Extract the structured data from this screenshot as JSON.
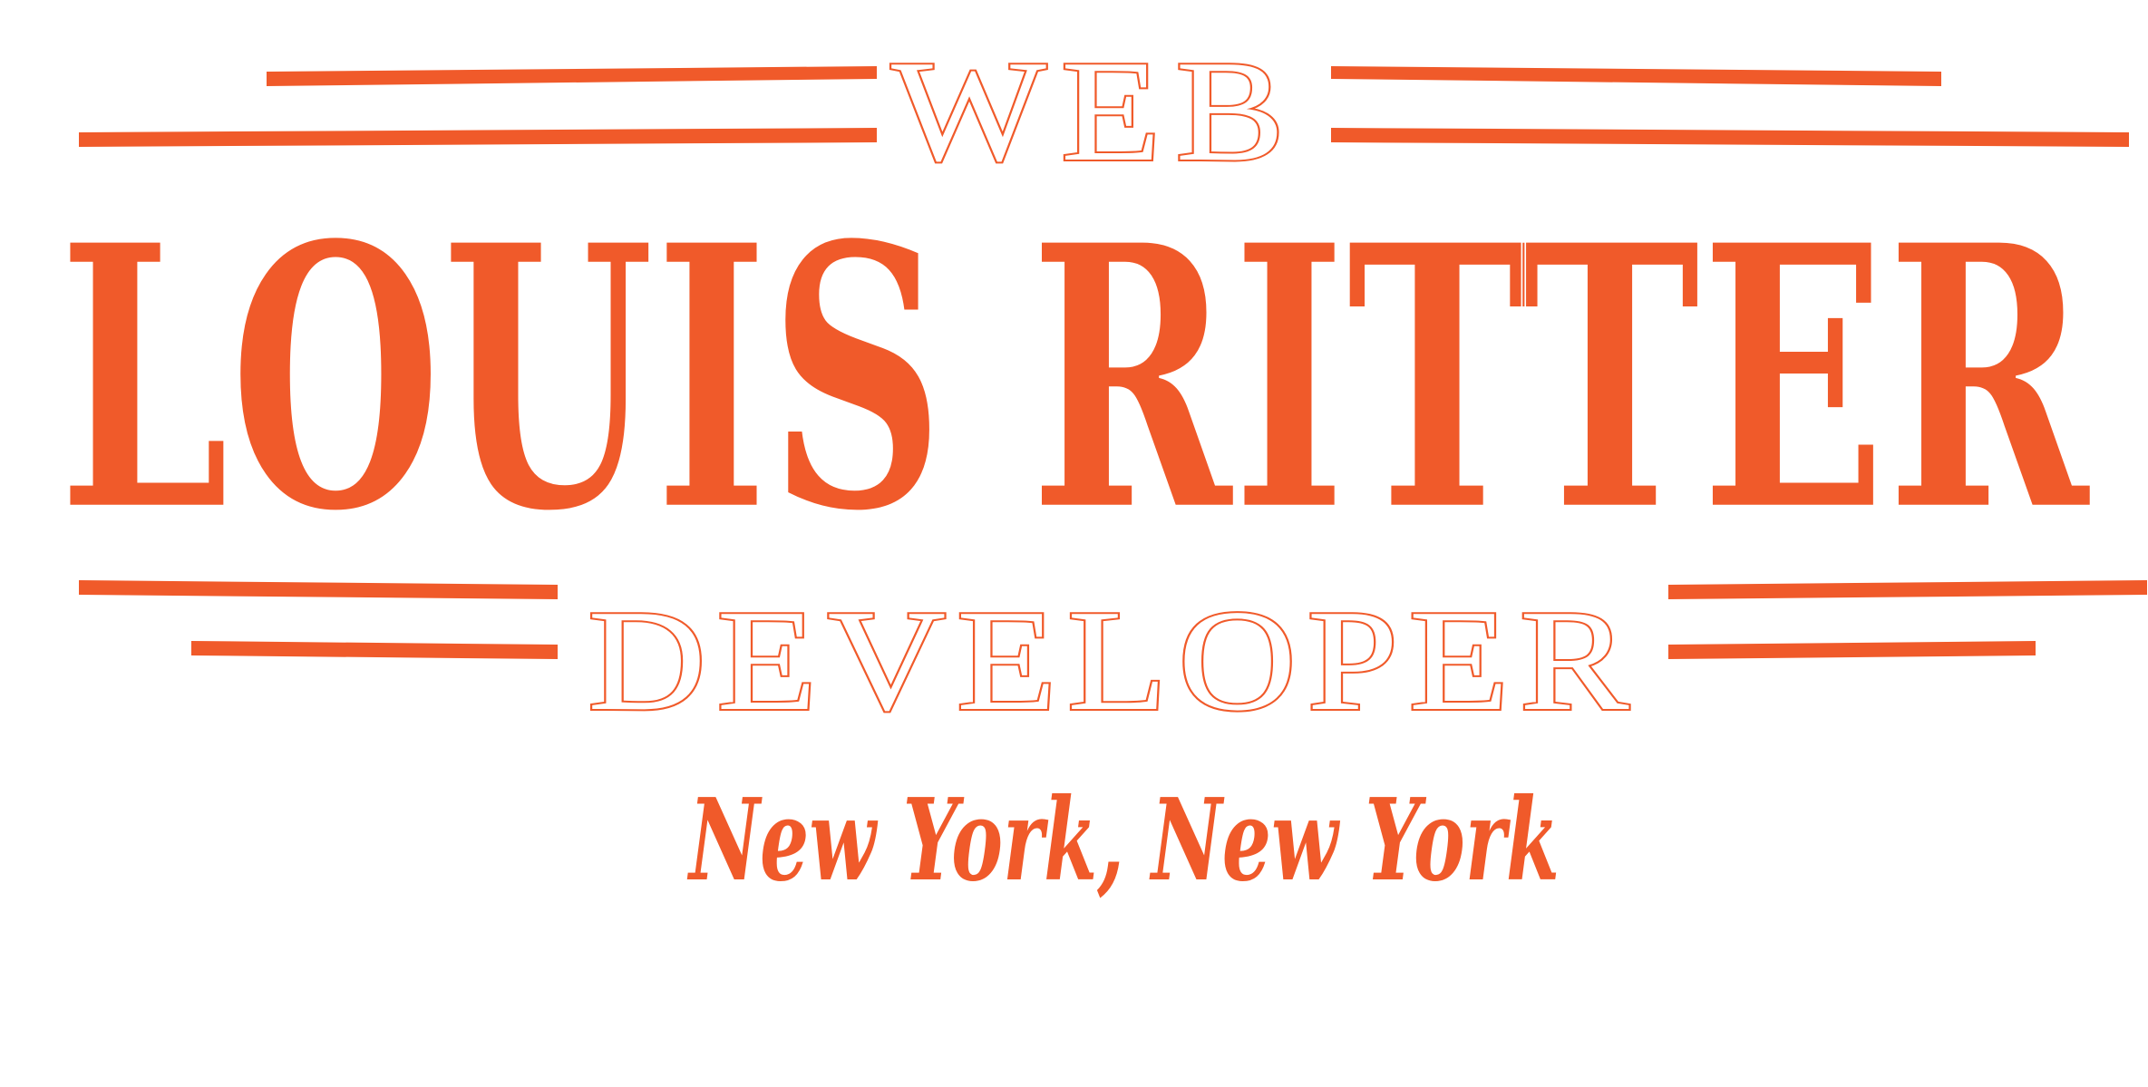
{
  "logo": {
    "top_word": "WEB",
    "name": "LOUIS RITTER",
    "bottom_word": "DEVELOPER",
    "location": "New York, New York",
    "accent_color": "#f05a2a",
    "background_color": "#ffffff"
  }
}
